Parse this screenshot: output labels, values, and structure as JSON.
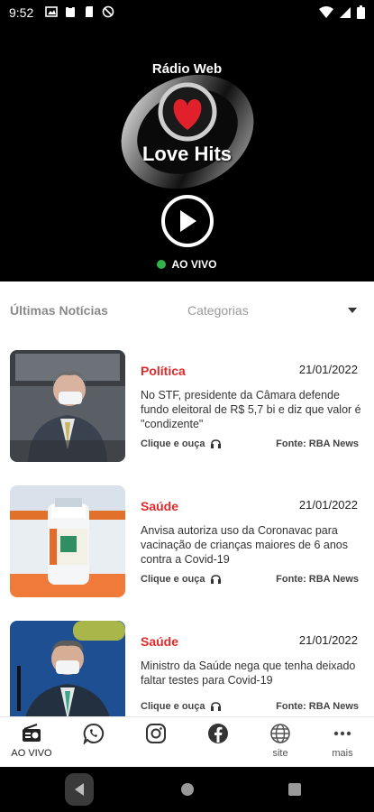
{
  "status_bar": {
    "time": "9:52",
    "left_icons": [
      "image-icon",
      "clipboard-icon",
      "sd-card-icon",
      "no-data-icon"
    ],
    "right_icons": [
      "wifi-icon",
      "signal-icon",
      "battery-icon"
    ]
  },
  "player": {
    "logo_top_text": "Rádio Web",
    "logo_main_text": "Love Hits",
    "live_label": "AO VIVO",
    "live_color": "#31b549"
  },
  "news": {
    "section_title": "Últimas Notícias",
    "category_filter": "Categorias",
    "items": [
      {
        "category": "Política",
        "date": "21/01/2022",
        "title": "No STF, presidente da Câmara defende fundo eleitoral de R$ 5,7 bi e diz que valor é \"condizente\"",
        "listen_label": "Clique e ouça",
        "source": "Fonte: RBA News"
      },
      {
        "category": "Saúde",
        "date": "21/01/2022",
        "title": "Anvisa autoriza uso da Coronavac para vacinação de crianças maiores de 6 anos contra a Covid-19",
        "listen_label": "Clique e ouça",
        "source": "Fonte: RBA News"
      },
      {
        "category": "Saúde",
        "date": "21/01/2022",
        "title": "Ministro da Saúde nega que tenha deixado faltar testes para Covid-19",
        "listen_label": "Clique e ouça",
        "source": "Fonte: RBA News"
      }
    ],
    "category_color": "#e32a2a"
  },
  "bottom_nav": {
    "items": [
      {
        "label": "AO VIVO",
        "icon": "radio-icon"
      },
      {
        "label": "",
        "icon": "whatsapp-icon"
      },
      {
        "label": "",
        "icon": "instagram-icon"
      },
      {
        "label": "",
        "icon": "facebook-icon"
      },
      {
        "label": "site",
        "icon": "globe-icon"
      },
      {
        "label": "mais",
        "icon": "more-icon"
      }
    ]
  }
}
